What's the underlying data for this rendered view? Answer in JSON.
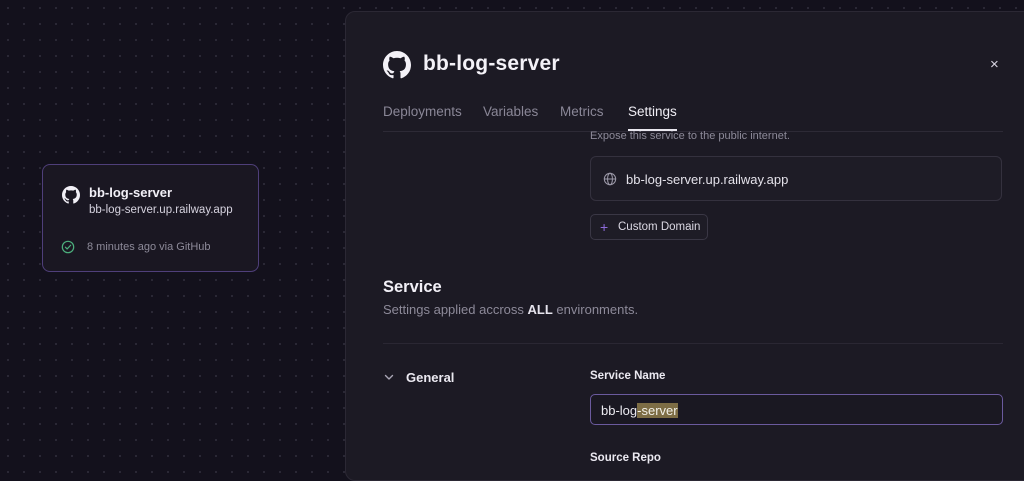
{
  "canvas_card": {
    "name": "bb-log-server",
    "url": "bb-log-server.up.railway.app",
    "status": "8 minutes ago via GitHub"
  },
  "panel": {
    "title": "bb-log-server",
    "close": "×",
    "tabs": [
      {
        "label": "Deployments",
        "active": false
      },
      {
        "label": "Variables",
        "active": false
      },
      {
        "label": "Metrics",
        "active": false
      },
      {
        "label": "Settings",
        "active": true
      }
    ],
    "networking": {
      "expose_text": "Expose this service to the public internet.",
      "domain": "bb-log-server.up.railway.app",
      "custom_domain_label": "Custom Domain"
    },
    "service": {
      "title": "Service",
      "desc_before": "Settings applied accross ",
      "desc_bold": "ALL",
      "desc_after": " environments.",
      "general_label": "General",
      "service_name_label": "Service Name",
      "service_name_value_plain": "bb-log",
      "service_name_value_selected": "-server",
      "source_repo_label": "Source Repo"
    }
  },
  "colors": {
    "background": "#13111c",
    "accent_purple": "#8d6bd9",
    "success_green": "#4caf7d",
    "selection": "#7d6d45"
  },
  "icons": [
    "github-icon",
    "check-circle-icon",
    "globe-icon",
    "plus-icon",
    "chevron-down-icon",
    "close-icon"
  ]
}
